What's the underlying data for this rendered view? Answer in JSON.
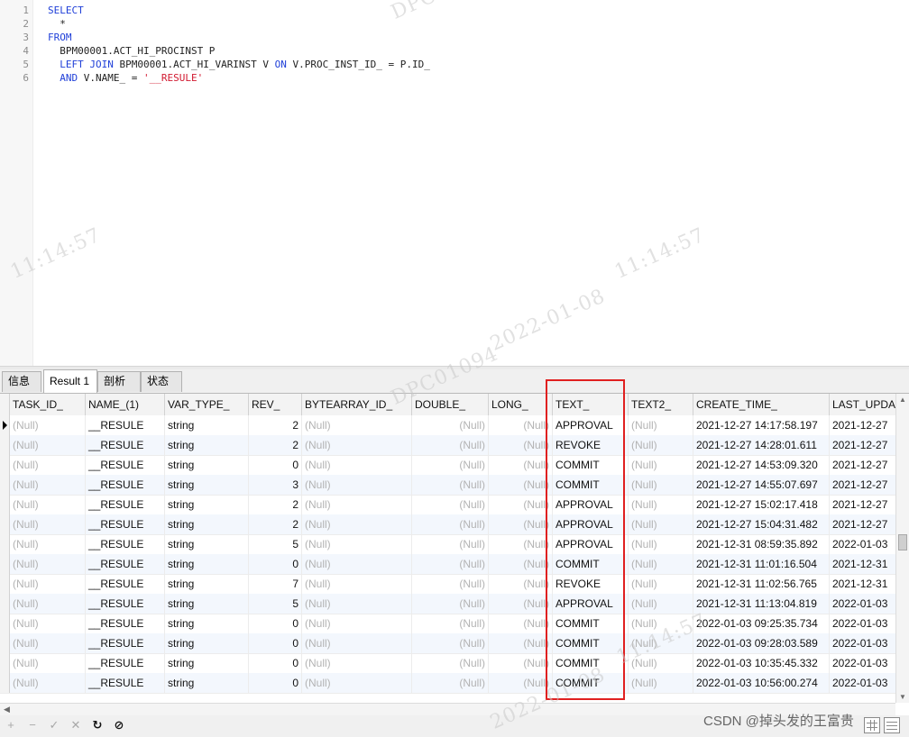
{
  "editor": {
    "line_numbers": [
      "1",
      "2",
      "3",
      "4",
      "5",
      "6"
    ],
    "lines": [
      [
        {
          "t": "SELECT",
          "c": "kw"
        }
      ],
      [
        {
          "t": "  *",
          "c": ""
        }
      ],
      [
        {
          "t": "FROM",
          "c": "kw"
        }
      ],
      [
        {
          "t": "  BPM00001.ACT_HI_PROCINST P",
          "c": ""
        }
      ],
      [
        {
          "t": "  ",
          "c": ""
        },
        {
          "t": "LEFT JOIN",
          "c": "kw"
        },
        {
          "t": " BPM00001.ACT_HI_VARINST V ",
          "c": ""
        },
        {
          "t": "ON",
          "c": "kw"
        },
        {
          "t": " V.PROC_INST_ID_ = P.ID_",
          "c": ""
        }
      ],
      [
        {
          "t": "  ",
          "c": ""
        },
        {
          "t": "AND",
          "c": "kw"
        },
        {
          "t": " V.NAME_ = ",
          "c": ""
        },
        {
          "t": "'__RESULE'",
          "c": "str"
        }
      ]
    ]
  },
  "tabs": [
    "信息",
    "Result 1",
    "剖析",
    "状态"
  ],
  "active_tab": "Result 1",
  "grid": {
    "columns": [
      "TASK_ID_",
      "NAME_(1)",
      "VAR_TYPE_",
      "REV_",
      "BYTEARRAY_ID_",
      "DOUBLE_",
      "LONG_",
      "TEXT_",
      "TEXT2_",
      "CREATE_TIME_",
      "LAST_UPDA"
    ],
    "null_text": "(Null)",
    "rows": [
      {
        "name": "__RESULE",
        "type": "string",
        "rev": "2",
        "text": "APPROVAL",
        "create": "2021-12-27 14:17:58.197",
        "last": "2021-12-27"
      },
      {
        "name": "__RESULE",
        "type": "string",
        "rev": "2",
        "text": "REVOKE",
        "create": "2021-12-27 14:28:01.611",
        "last": "2021-12-27"
      },
      {
        "name": "__RESULE",
        "type": "string",
        "rev": "0",
        "text": "COMMIT",
        "create": "2021-12-27 14:53:09.320",
        "last": "2021-12-27"
      },
      {
        "name": "__RESULE",
        "type": "string",
        "rev": "3",
        "text": "COMMIT",
        "create": "2021-12-27 14:55:07.697",
        "last": "2021-12-27"
      },
      {
        "name": "__RESULE",
        "type": "string",
        "rev": "2",
        "text": "APPROVAL",
        "create": "2021-12-27 15:02:17.418",
        "last": "2021-12-27"
      },
      {
        "name": "__RESULE",
        "type": "string",
        "rev": "2",
        "text": "APPROVAL",
        "create": "2021-12-27 15:04:31.482",
        "last": "2021-12-27"
      },
      {
        "name": "__RESULE",
        "type": "string",
        "rev": "5",
        "text": "APPROVAL",
        "create": "2021-12-31 08:59:35.892",
        "last": "2022-01-03"
      },
      {
        "name": "__RESULE",
        "type": "string",
        "rev": "0",
        "text": "COMMIT",
        "create": "2021-12-31 11:01:16.504",
        "last": "2021-12-31"
      },
      {
        "name": "__RESULE",
        "type": "string",
        "rev": "7",
        "text": "REVOKE",
        "create": "2021-12-31 11:02:56.765",
        "last": "2021-12-31"
      },
      {
        "name": "__RESULE",
        "type": "string",
        "rev": "5",
        "text": "APPROVAL",
        "create": "2021-12-31 11:13:04.819",
        "last": "2022-01-03"
      },
      {
        "name": "__RESULE",
        "type": "string",
        "rev": "0",
        "text": "COMMIT",
        "create": "2022-01-03 09:25:35.734",
        "last": "2022-01-03"
      },
      {
        "name": "__RESULE",
        "type": "string",
        "rev": "0",
        "text": "COMMIT",
        "create": "2022-01-03 09:28:03.589",
        "last": "2022-01-03"
      },
      {
        "name": "__RESULE",
        "type": "string",
        "rev": "0",
        "text": "COMMIT",
        "create": "2022-01-03 10:35:45.332",
        "last": "2022-01-03"
      },
      {
        "name": "__RESULE",
        "type": "string",
        "rev": "0",
        "text": "COMMIT",
        "create": "2022-01-03 10:56:00.274",
        "last": "2022-01-03"
      }
    ]
  },
  "toolbar": {
    "add": "+",
    "remove": "−",
    "apply": "✓",
    "discard": "✕",
    "refresh": "↻",
    "stop": "⊘"
  },
  "watermark": {
    "time": "11:14:57",
    "date": "2022-01-08",
    "id": "DPC01094"
  },
  "attribution": "CSDN @掉头发的王富贵"
}
